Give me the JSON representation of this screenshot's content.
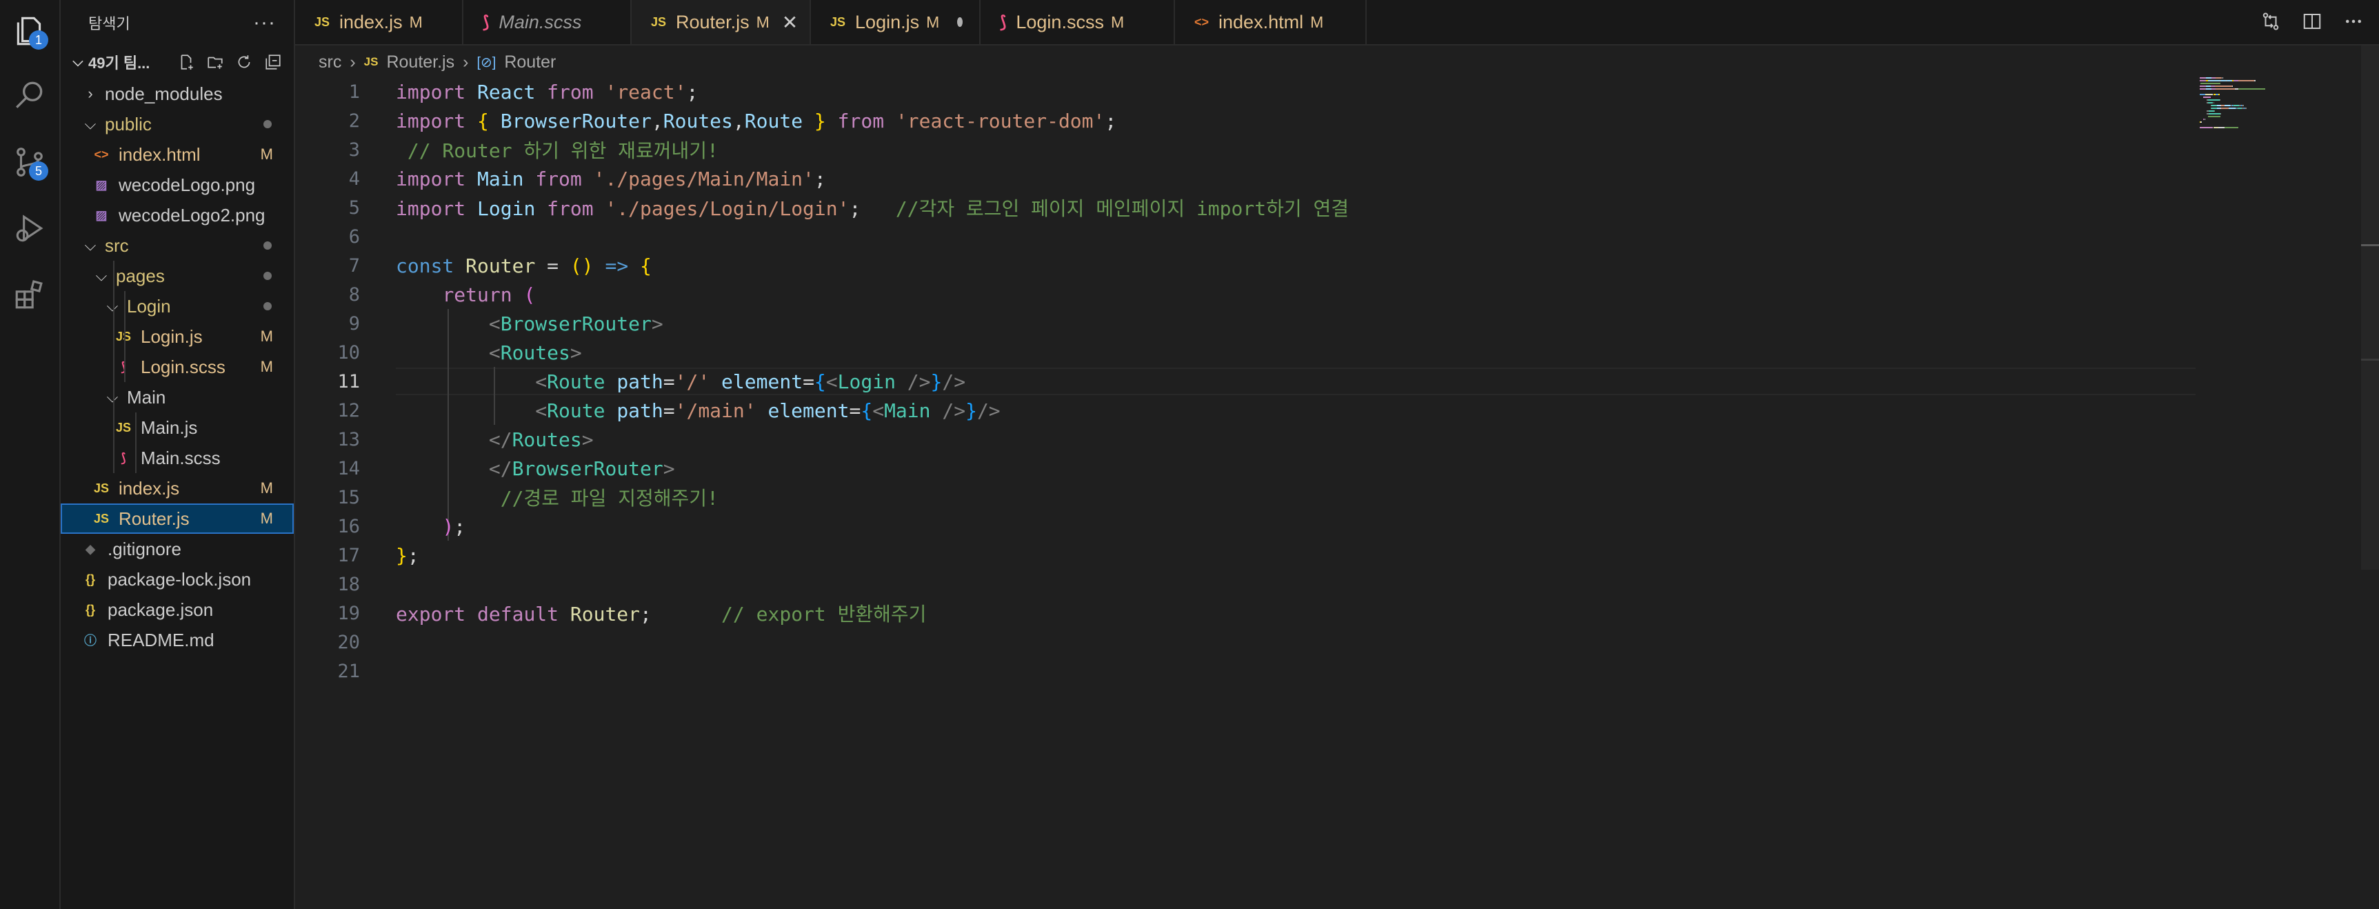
{
  "activity_bar": {
    "items": [
      {
        "name": "explorer",
        "badge": "1"
      },
      {
        "name": "search",
        "badge": ""
      },
      {
        "name": "source-control",
        "badge": "5"
      },
      {
        "name": "run-debug",
        "badge": ""
      },
      {
        "name": "extensions",
        "badge": ""
      }
    ]
  },
  "sidebar": {
    "title": "탐색기",
    "more": "···",
    "project": "49기 팀...",
    "tree": [
      {
        "label": "node_modules",
        "type": "folder-closed",
        "depth": 0,
        "mark": "",
        "dot": false
      },
      {
        "label": "public",
        "type": "folder-open",
        "depth": 0,
        "mark": "",
        "dot": true
      },
      {
        "label": "index.html",
        "type": "html",
        "depth": 1,
        "mark": "M",
        "dot": false
      },
      {
        "label": "wecodeLogo.png",
        "type": "image",
        "depth": 1,
        "mark": "",
        "dot": false
      },
      {
        "label": "wecodeLogo2.png",
        "type": "image",
        "depth": 1,
        "mark": "",
        "dot": false
      },
      {
        "label": "src",
        "type": "folder-open",
        "depth": 0,
        "mark": "",
        "dot": true
      },
      {
        "label": "pages",
        "type": "folder-open",
        "depth": 1,
        "mark": "",
        "dot": true
      },
      {
        "label": "Login",
        "type": "folder-open",
        "depth": 2,
        "mark": "",
        "dot": true
      },
      {
        "label": "Login.js",
        "type": "js",
        "depth": 3,
        "mark": "M",
        "dot": false
      },
      {
        "label": "Login.scss",
        "type": "scss",
        "depth": 3,
        "mark": "M",
        "dot": false
      },
      {
        "label": "Main",
        "type": "folder-open",
        "depth": 2,
        "mark": "",
        "dot": false
      },
      {
        "label": "Main.js",
        "type": "js",
        "depth": 3,
        "mark": "",
        "dot": false
      },
      {
        "label": "Main.scss",
        "type": "scss",
        "depth": 3,
        "mark": "",
        "dot": false
      },
      {
        "label": "index.js",
        "type": "js",
        "depth": 1,
        "mark": "M",
        "dot": false
      },
      {
        "label": "Router.js",
        "type": "js",
        "depth": 1,
        "mark": "M",
        "dot": false
      },
      {
        "label": ".gitignore",
        "type": "git",
        "depth": 0,
        "mark": "",
        "dot": false
      },
      {
        "label": "package-lock.json",
        "type": "json",
        "depth": 0,
        "mark": "",
        "dot": false
      },
      {
        "label": "package.json",
        "type": "json",
        "depth": 0,
        "mark": "",
        "dot": false
      },
      {
        "label": "README.md",
        "type": "info",
        "depth": 0,
        "mark": "",
        "dot": false
      }
    ]
  },
  "tabs": [
    {
      "label": "index.js",
      "icon": "JS",
      "mark": "M",
      "active": false,
      "italic": false,
      "dirty": false
    },
    {
      "label": "Main.scss",
      "icon": "scss",
      "mark": "",
      "active": false,
      "italic": true,
      "dirty": false
    },
    {
      "label": "Router.js",
      "icon": "JS",
      "mark": "M",
      "active": true,
      "italic": false,
      "dirty": false
    },
    {
      "label": "Login.js",
      "icon": "JS",
      "mark": "M",
      "active": false,
      "italic": false,
      "dirty": true
    },
    {
      "label": "Login.scss",
      "icon": "scss",
      "mark": "M",
      "active": false,
      "italic": false,
      "dirty": false
    },
    {
      "label": "index.html",
      "icon": "html",
      "mark": "M",
      "active": false,
      "italic": false,
      "dirty": false
    }
  ],
  "breadcrumb": {
    "folder": "src",
    "file_icon": "JS",
    "file": "Router.js",
    "symbol": "Router"
  },
  "editor": {
    "current_line": 11,
    "lines": [
      [
        [
          "kw",
          "import "
        ],
        [
          "id",
          "React "
        ],
        [
          "kw",
          "from "
        ],
        [
          "str",
          "'react'"
        ],
        [
          "plain",
          ";"
        ]
      ],
      [
        [
          "kw",
          "import "
        ],
        [
          "br1",
          "{ "
        ],
        [
          "id",
          "BrowserRouter"
        ],
        [
          "plain",
          ","
        ],
        [
          "id",
          "Routes"
        ],
        [
          "plain",
          ","
        ],
        [
          "id",
          "Route "
        ],
        [
          "br1",
          "} "
        ],
        [
          "kw",
          "from "
        ],
        [
          "str",
          "'react-router-dom'"
        ],
        [
          "plain",
          ";"
        ]
      ],
      [
        [
          "com",
          " // Router 하기 위한 재료꺼내기!"
        ]
      ],
      [
        [
          "kw",
          "import "
        ],
        [
          "id",
          "Main "
        ],
        [
          "kw",
          "from "
        ],
        [
          "str",
          "'./pages/Main/Main'"
        ],
        [
          "plain",
          ";"
        ]
      ],
      [
        [
          "kw",
          "import "
        ],
        [
          "id",
          "Login "
        ],
        [
          "kw",
          "from "
        ],
        [
          "str",
          "'./pages/Login/Login'"
        ],
        [
          "plain",
          ";   "
        ],
        [
          "com",
          "//각자 로그인 페이지 메인페이지 import하기 연결"
        ]
      ],
      [],
      [
        [
          "kb",
          "const "
        ],
        [
          "fn",
          "Router "
        ],
        [
          "plain",
          "= "
        ],
        [
          "br1",
          "() "
        ],
        [
          "kb",
          "=> "
        ],
        [
          "br1",
          "{"
        ]
      ],
      [
        [
          "plain",
          "    "
        ],
        [
          "kw",
          "return "
        ],
        [
          "br2",
          "("
        ]
      ],
      [
        [
          "plain",
          "        "
        ],
        [
          "punc",
          "<"
        ],
        [
          "tag",
          "BrowserRouter"
        ],
        [
          "punc",
          ">"
        ]
      ],
      [
        [
          "plain",
          "        "
        ],
        [
          "punc",
          "<"
        ],
        [
          "tag",
          "Routes"
        ],
        [
          "punc",
          ">"
        ]
      ],
      [
        [
          "plain",
          "            "
        ],
        [
          "punc",
          "<"
        ],
        [
          "tag",
          "Route "
        ],
        [
          "id",
          "path"
        ],
        [
          "plain",
          "="
        ],
        [
          "str",
          "'/' "
        ],
        [
          "id",
          "element"
        ],
        [
          "plain",
          "="
        ],
        [
          "br3",
          "{"
        ],
        [
          "punc",
          "<"
        ],
        [
          "tag",
          "Login "
        ],
        [
          "punc",
          "/>"
        ],
        [
          "br3",
          "}"
        ],
        [
          "punc",
          "/>"
        ]
      ],
      [
        [
          "plain",
          "            "
        ],
        [
          "punc",
          "<"
        ],
        [
          "tag",
          "Route "
        ],
        [
          "id",
          "path"
        ],
        [
          "plain",
          "="
        ],
        [
          "str",
          "'/main' "
        ],
        [
          "id",
          "element"
        ],
        [
          "plain",
          "="
        ],
        [
          "br3",
          "{"
        ],
        [
          "punc",
          "<"
        ],
        [
          "tag",
          "Main "
        ],
        [
          "punc",
          "/>"
        ],
        [
          "br3",
          "}"
        ],
        [
          "punc",
          "/>"
        ]
      ],
      [
        [
          "plain",
          "        "
        ],
        [
          "punc",
          "</"
        ],
        [
          "tag",
          "Routes"
        ],
        [
          "punc",
          ">"
        ]
      ],
      [
        [
          "plain",
          "        "
        ],
        [
          "punc",
          "</"
        ],
        [
          "tag",
          "BrowserRouter"
        ],
        [
          "punc",
          ">"
        ]
      ],
      [
        [
          "plain",
          "         "
        ],
        [
          "com",
          "//경로 파일 지정해주기!"
        ]
      ],
      [
        [
          "plain",
          "    "
        ],
        [
          "br2",
          ")"
        ],
        [
          "plain",
          ";"
        ]
      ],
      [
        [
          "br1",
          "}"
        ],
        [
          "plain",
          ";"
        ]
      ],
      [],
      [
        [
          "kw",
          "export "
        ],
        [
          "kw",
          "default "
        ],
        [
          "fn",
          "Router"
        ],
        [
          "plain",
          ";      "
        ],
        [
          "com",
          "// export 반환해주기"
        ]
      ],
      [],
      []
    ]
  },
  "colors": {
    "background": "#1f1f1f",
    "sidebar": "#181818",
    "modified": "#e2c08d",
    "accent": "#2f7ad6",
    "selection": "#04395e"
  }
}
